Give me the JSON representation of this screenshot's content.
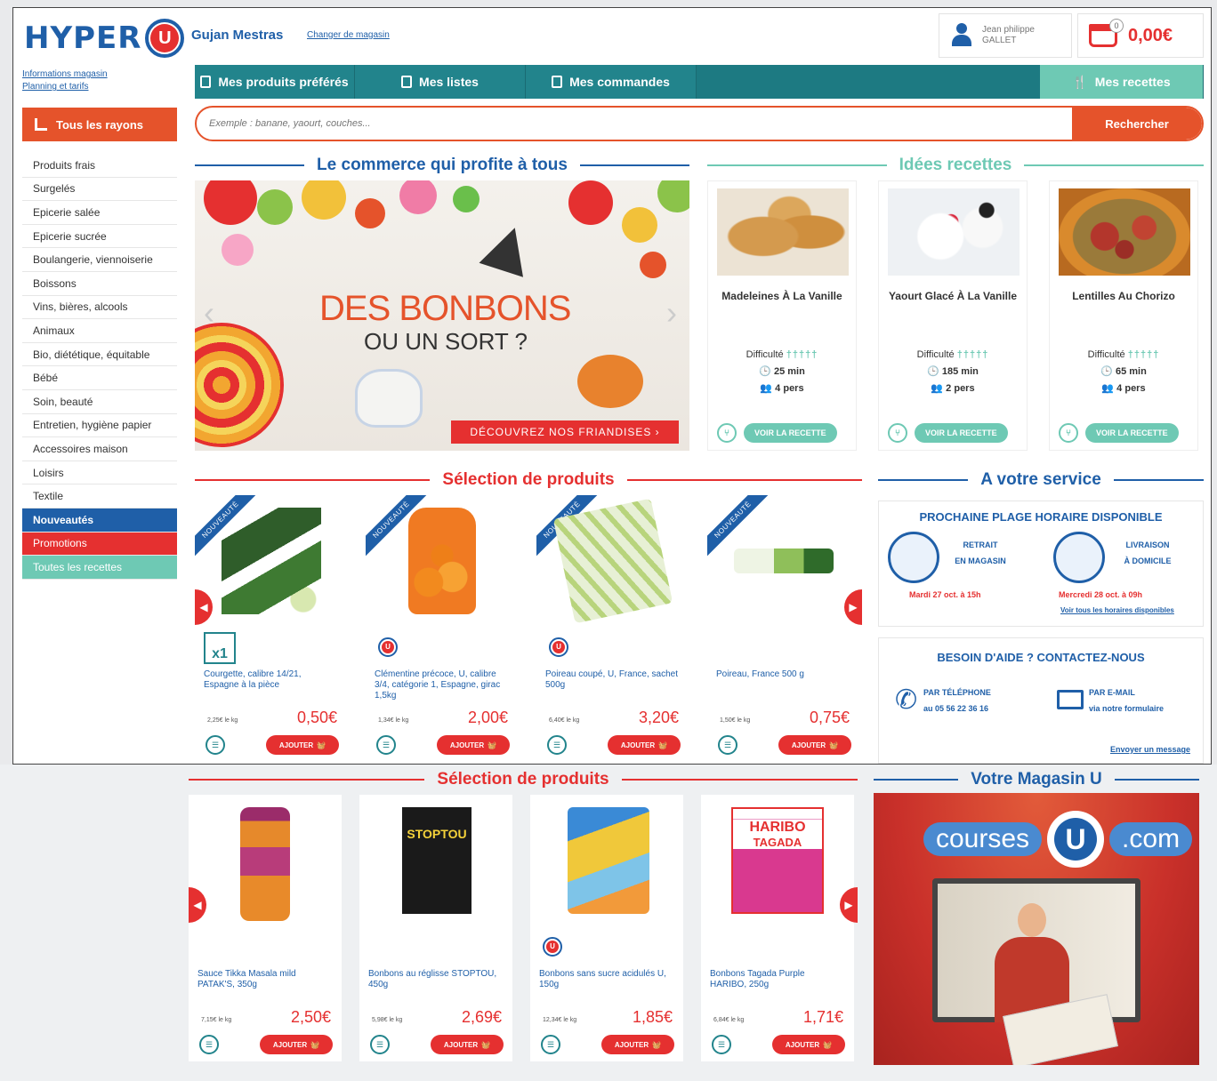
{
  "header": {
    "logo_text": "HYPER",
    "logo_u": "U",
    "store_name": "Gujan Mestras",
    "change_store": "Changer de magasin",
    "user_name": "Jean philippe GALLET",
    "cart_count": "0",
    "cart_total": "0,00€",
    "info_link": "Informations magasin",
    "pricing_link": "Planning et tarifs"
  },
  "nav": {
    "tabs": [
      {
        "label": "Mes produits préférés",
        "icon": "list-icon"
      },
      {
        "label": "Mes listes",
        "icon": "clipboard-icon"
      },
      {
        "label": "Mes commandes",
        "icon": "receipt-icon"
      }
    ],
    "recipes_label": "Mes recettes",
    "rayons_label": "Tous les rayons"
  },
  "search": {
    "placeholder": "Exemple : banane, yaourt, couches...",
    "button": "Rechercher"
  },
  "sidebar": {
    "items": [
      "Produits frais",
      "Surgelés",
      "Epicerie salée",
      "Epicerie sucrée",
      "Boulangerie, viennoiserie",
      "Boissons",
      "Vins, bières, alcools",
      "Animaux",
      "Bio, diététique, équitable",
      "Bébé",
      "Soin, beauté",
      "Entretien, hygiène papier",
      "Accessoires maison",
      "Loisirs",
      "Textile"
    ],
    "new_label": "Nouveautés",
    "promo_label": "Promotions",
    "recipes_label": "Toutes les recettes"
  },
  "sections": {
    "commerce": "Le commerce qui profite à tous",
    "recipes": "Idées recettes",
    "selection": "Sélection de produits",
    "service": "A votre service",
    "store": "Votre Magasin U"
  },
  "banner": {
    "title": "DES BONBONS",
    "subtitle": "OU UN SORT ?",
    "cta": "DÉCOUVREZ NOS FRIANDISES  ›"
  },
  "recipes": [
    {
      "title": "Madeleines À La Vanille",
      "difficulty_label": "Difficulté",
      "difficulty": "†††††",
      "time": "25 min",
      "people": "4 pers",
      "button": "VOIR LA RECETTE"
    },
    {
      "title": "Yaourt Glacé À La Vanille",
      "difficulty_label": "Difficulté",
      "difficulty": "†††††",
      "time": "185 min",
      "people": "2 pers",
      "button": "VOIR LA RECETTE"
    },
    {
      "title": "Lentilles Au Chorizo",
      "difficulty_label": "Difficulté",
      "difficulty": "†††††",
      "time": "65 min",
      "people": "4 pers",
      "button": "VOIR LA RECETTE"
    }
  ],
  "products_top": [
    {
      "badge": "NOUVEAUTÉ",
      "name": "Courgette, calibre 14/21, Espagne à la pièce",
      "per_kg": "2,25€ le kg",
      "price": "0,50€",
      "piece": "x1",
      "add": "AJOUTER"
    },
    {
      "badge": "NOUVEAUTÉ",
      "name": "Clémentine précoce, U, calibre 3/4, catégorie 1, Espagne, girac 1,5kg",
      "per_kg": "1,34€ le kg",
      "price": "2,00€",
      "add": "AJOUTER"
    },
    {
      "badge": "NOUVEAUTÉ",
      "name": "Poireau coupé, U, France, sachet 500g",
      "per_kg": "6,40€ le kg",
      "price": "3,20€",
      "add": "AJOUTER"
    },
    {
      "badge": "NOUVEAUTÉ",
      "name": "Poireau, France 500 g",
      "per_kg": "1,50€ le kg",
      "price": "0,75€",
      "add": "AJOUTER"
    }
  ],
  "products_bottom": [
    {
      "name": "Sauce Tikka Masala mild PATAK'S, 350g",
      "per_kg": "7,15€ le kg",
      "price": "2,50€",
      "add": "AJOUTER"
    },
    {
      "name": "Bonbons au réglisse STOPTOU, 450g",
      "per_kg": "5,98€ le kg",
      "price": "2,69€",
      "add": "AJOUTER"
    },
    {
      "name": "Bonbons sans sucre acidulés U, 150g",
      "per_kg": "12,34€ le kg",
      "price": "1,85€",
      "add": "AJOUTER"
    },
    {
      "name": "Bonbons Tagada Purple HARIBO, 250g",
      "per_kg": "6,84€ le kg",
      "price": "1,71€",
      "add": "AJOUTER"
    }
  ],
  "product_image_labels": {
    "stoptou": "STOPTOU",
    "haribo": "HARIBO",
    "tagada": "TAGADA"
  },
  "service": {
    "slot_title": "PROCHAINE PLAGE HORAIRE DISPONIBLE",
    "pickup_line1": "RETRAIT",
    "pickup_line2": "EN MAGASIN",
    "pickup_date": "Mardi 27 oct. à 15h",
    "delivery_line1": "LIVRAISON",
    "delivery_line2": "À DOMICILE",
    "delivery_date": "Mercredi 28 oct. à 09h",
    "all_slots": "Voir tous les horaires disponibles",
    "help_title": "BESOIN D'AIDE ? CONTACTEZ-NOUS",
    "phone_line1": "PAR TÉLÉPHONE",
    "phone_line2": "au 05 56 22 36 16",
    "mail_line1": "PAR E-MAIL",
    "mail_line2": "via notre formulaire",
    "send_message": "Envoyer un message"
  },
  "store_ad": {
    "left": "courses",
    "u": "U",
    "right": ".com"
  },
  "colors": {
    "brand_blue": "#1f5fa8",
    "brand_red": "#e53030",
    "orange": "#e5532b",
    "teal": "#22848c",
    "mint": "#6ec9b4"
  }
}
